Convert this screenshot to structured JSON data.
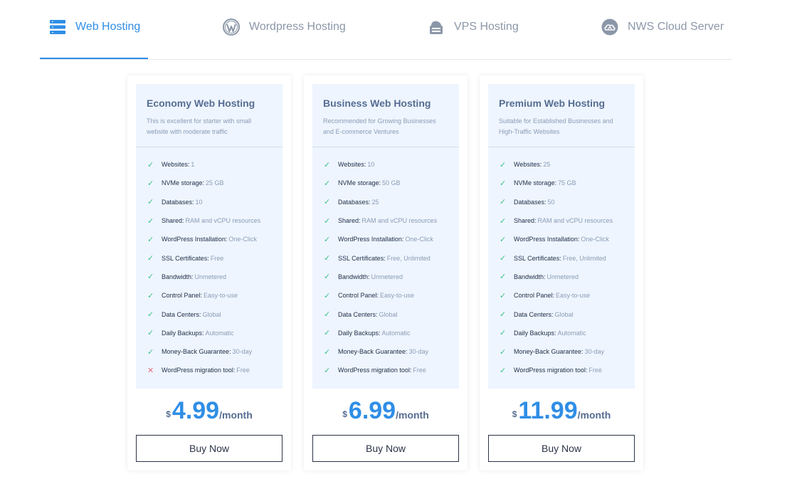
{
  "tabs": [
    {
      "label": "Web Hosting",
      "icon": "server-icon",
      "active": true
    },
    {
      "label": "Wordpress Hosting",
      "icon": "wordpress-icon",
      "active": false
    },
    {
      "label": "VPS Hosting",
      "icon": "vps-icon",
      "active": false
    },
    {
      "label": "NWS Cloud Server",
      "icon": "cloud-icon",
      "active": false
    }
  ],
  "colors": {
    "accent": "#2f8ee6",
    "check": "#3cbf8a",
    "cross": "#e2707e",
    "card_bg": "#eef5ff"
  },
  "plans": [
    {
      "title": "Economy Web Hosting",
      "desc_line1": "This is excellent for starter with small",
      "desc_line2": "website with moderate traffic",
      "features": [
        {
          "label": "Websites:",
          "value": "1",
          "included": true
        },
        {
          "label": "NVMe storage:",
          "value": "25 GB",
          "included": true
        },
        {
          "label": "Databases:",
          "value": "10",
          "included": true
        },
        {
          "label": "Shared:",
          "value": "RAM and vCPU resources",
          "included": true
        },
        {
          "label": "WordPress Installation:",
          "value": "One-Click",
          "included": true
        },
        {
          "label": "SSL Certificates:",
          "value": "Free",
          "included": true
        },
        {
          "label": "Bandwidth:",
          "value": "Unmetered",
          "included": true
        },
        {
          "label": "Control Panel:",
          "value": "Easy-to-use",
          "included": true
        },
        {
          "label": "Data Centers:",
          "value": "Global",
          "included": true
        },
        {
          "label": "Daily Backups:",
          "value": "Automatic",
          "included": true
        },
        {
          "label": "Money-Back Guarantee:",
          "value": "30-day",
          "included": true
        },
        {
          "label": "WordPress migration tool:",
          "value": "Free",
          "included": false
        }
      ],
      "currency": "$",
      "price": "4.99",
      "period": "/month",
      "button": "Buy Now"
    },
    {
      "title": "Business Web Hosting",
      "desc_line1": "Recommended for Growing Businesses",
      "desc_line2": "and E-commerce Ventures",
      "features": [
        {
          "label": "Websites:",
          "value": "10",
          "included": true
        },
        {
          "label": "NVMe storage:",
          "value": "50 GB",
          "included": true
        },
        {
          "label": "Databases:",
          "value": "25",
          "included": true
        },
        {
          "label": "Shared:",
          "value": "RAM and vCPU resources",
          "included": true
        },
        {
          "label": "WordPress Installation:",
          "value": "One-Click",
          "included": true
        },
        {
          "label": "SSL Certificates:",
          "value": "Free, Unlimited",
          "included": true
        },
        {
          "label": "Bandwidth:",
          "value": "Unmetered",
          "included": true
        },
        {
          "label": "Control Panel:",
          "value": "Easy-to-use",
          "included": true
        },
        {
          "label": "Data Centers:",
          "value": "Global",
          "included": true
        },
        {
          "label": "Daily Backups:",
          "value": "Automatic",
          "included": true
        },
        {
          "label": "Money-Back Guarantee:",
          "value": "30-day",
          "included": true
        },
        {
          "label": "WordPress migration tool:",
          "value": "Free",
          "included": true
        }
      ],
      "currency": "$",
      "price": "6.99",
      "period": "/month",
      "button": "Buy Now"
    },
    {
      "title": "Premium Web Hosting",
      "desc_line1": "Suitable for Established Businesses and",
      "desc_line2": "High-Traffic Websites",
      "features": [
        {
          "label": "Websites:",
          "value": "25",
          "included": true
        },
        {
          "label": "NVMe storage:",
          "value": "75 GB",
          "included": true
        },
        {
          "label": "Databases:",
          "value": "50",
          "included": true
        },
        {
          "label": "Shared:",
          "value": "RAM and vCPU resources",
          "included": true
        },
        {
          "label": "WordPress Installation:",
          "value": "One-Click",
          "included": true
        },
        {
          "label": "SSL Certificates:",
          "value": "Free, Unlimited",
          "included": true
        },
        {
          "label": "Bandwidth:",
          "value": "Unmetered",
          "included": true
        },
        {
          "label": "Control Panel:",
          "value": "Easy-to-use",
          "included": true
        },
        {
          "label": "Data Centers:",
          "value": "Global",
          "included": true
        },
        {
          "label": "Daily Backups:",
          "value": "Automatic",
          "included": true
        },
        {
          "label": "Money-Back Guarantee:",
          "value": "30-day",
          "included": true
        },
        {
          "label": "WordPress migration tool:",
          "value": "Free",
          "included": true
        }
      ],
      "currency": "$",
      "price": "11.99",
      "period": "/month",
      "button": "Buy Now"
    }
  ]
}
